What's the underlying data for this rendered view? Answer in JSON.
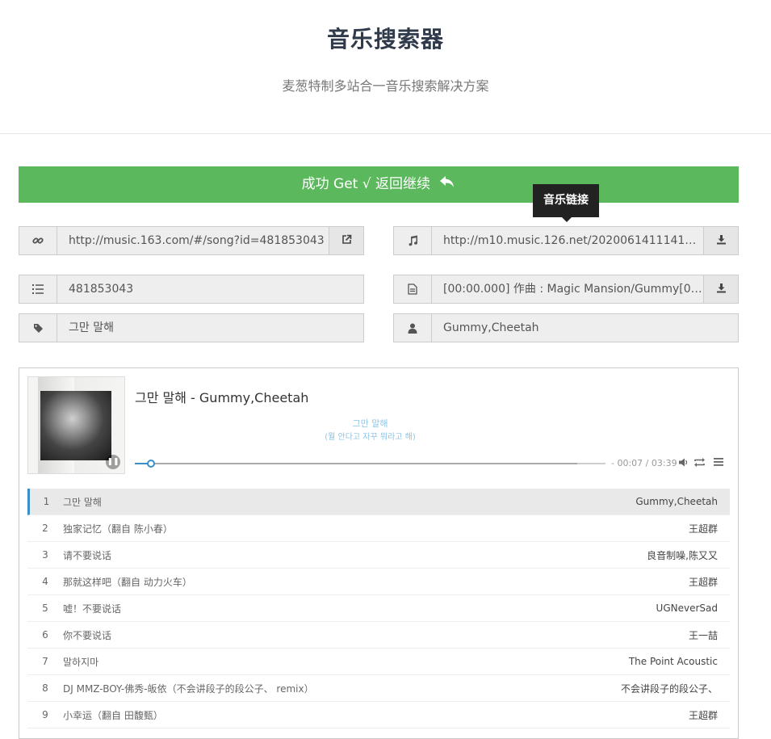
{
  "header": {
    "title": "音乐搜索器",
    "subtitle": "麦葱特制多站合一音乐搜索解决方案"
  },
  "success": {
    "label": "成功 Get √ 返回继续",
    "icon": "reply-icon"
  },
  "tooltip": {
    "label": "音乐链接"
  },
  "fields": {
    "song_link": {
      "icon": "link-icon",
      "value": "http://music.163.com/#/song?id=481853043",
      "button_icon": "external-link-icon"
    },
    "music_url": {
      "icon": "music-icon",
      "value": "http://m10.music.126.net/20200614111417/f941...",
      "button_icon": "download-icon"
    },
    "song_id": {
      "icon": "list-icon",
      "value": "481853043"
    },
    "lyrics": {
      "icon": "file-icon",
      "value": "[00:00.000] 作曲 : Magic Mansion/Gummy[00:00...",
      "button_icon": "download-icon"
    },
    "song_name": {
      "icon": "tag-icon",
      "value": "그만 말해"
    },
    "singer": {
      "icon": "user-icon",
      "value": "Gummy,Cheetah"
    }
  },
  "player": {
    "title": "그만 말해 - Gummy,Cheetah",
    "lyric_line1": "그만 말해",
    "lyric_line2": "(뭘 안다고 자꾸 뭐라고 해)",
    "time": "- 00:07 / 03:39",
    "progress_played": 0.034,
    "progress_loaded": 0.94
  },
  "playlist": [
    {
      "index": "1",
      "name": "그만 말해",
      "artist": "Gummy,Cheetah",
      "active": true
    },
    {
      "index": "2",
      "name": "独家记忆（翻自 陈小春）",
      "artist": "王超群"
    },
    {
      "index": "3",
      "name": "请不要说话",
      "artist": "良音制噪,陈又又"
    },
    {
      "index": "4",
      "name": "那就这样吧（翻自 动力火车）",
      "artist": "王超群"
    },
    {
      "index": "5",
      "name": "嘘！不要说话",
      "artist": "UGNeverSad"
    },
    {
      "index": "6",
      "name": "你不要说话",
      "artist": "王一喆"
    },
    {
      "index": "7",
      "name": "말하지마",
      "artist": "The Point Acoustic"
    },
    {
      "index": "8",
      "name": "DJ MMZ-BOY-佛秀-皈依（不会讲段子的段公子、 remix）",
      "artist": "不会讲段子的段公子、"
    },
    {
      "index": "9",
      "name": "小幸运（翻自 田馥甄）",
      "artist": "王超群"
    }
  ],
  "colors": {
    "success": "#5cb85c",
    "accent": "#3a8fc6",
    "lyric": "#8cc4e4",
    "tooltip": "#222222"
  }
}
